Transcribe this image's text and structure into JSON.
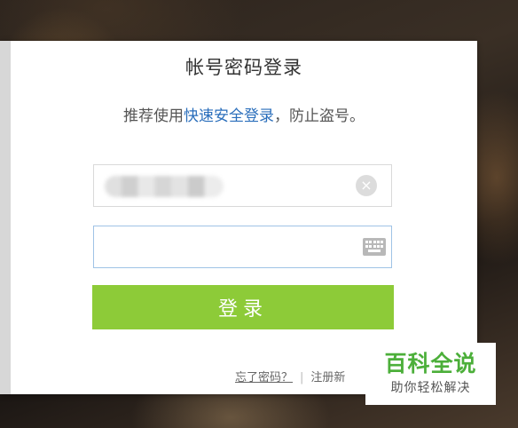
{
  "dialog": {
    "title": "帐号密码登录",
    "subtitle_prefix": "推荐使用",
    "subtitle_link": "快速安全登录",
    "subtitle_suffix": "，防止盗号。"
  },
  "form": {
    "username_value": "",
    "password_value": "",
    "clear_icon": "×",
    "login_label": "登录"
  },
  "footer": {
    "forgot_label": "忘了密码？",
    "separator": "|",
    "register_label": "注册新"
  },
  "watermark": {
    "brand": "百科全说",
    "slogan": "助你轻松解决"
  },
  "icons": {
    "clear": "clear-icon",
    "keyboard": "keyboard-icon"
  },
  "colors": {
    "login_button": "#8dcb38",
    "link": "#2a6ebb",
    "password_border": "#9fc3e6",
    "watermark_brand": "#4caf3a"
  }
}
